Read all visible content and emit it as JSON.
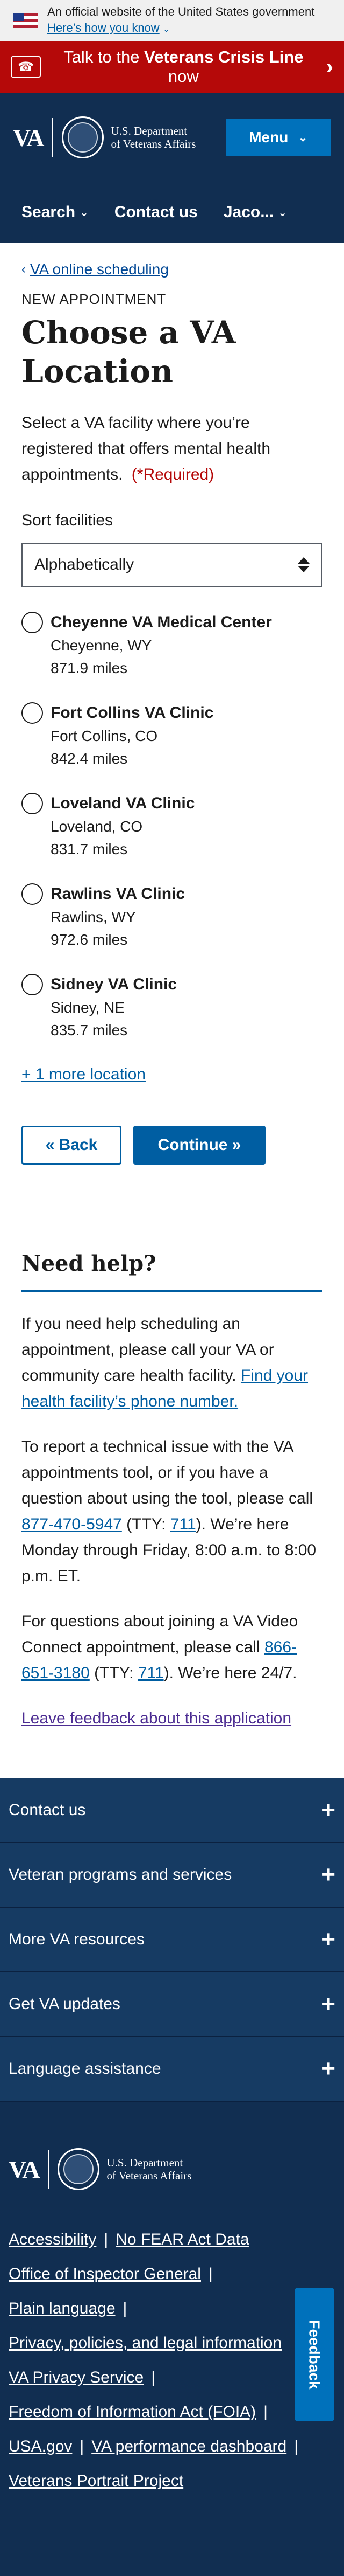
{
  "gov_banner": {
    "text": "An official website of the United States government",
    "link": "Here’s how you know"
  },
  "crisis": {
    "prefix": "Talk to the ",
    "emphasis": "Veterans Crisis Line",
    "suffix": " now"
  },
  "header": {
    "logo": "VA",
    "dept_line1": "U.S. Department",
    "dept_line2": "of Veterans Affairs",
    "menu_label": "Menu",
    "nav": [
      "Search",
      "Contact us",
      "Jaco..."
    ]
  },
  "main": {
    "breadcrumb": "VA online scheduling",
    "eyebrow": "NEW APPOINTMENT",
    "title": "Choose a VA Location",
    "intro": "Select a VA facility where you’re registered that offers mental health appointments.",
    "required": "(*Required)",
    "sort_label": "Sort facilities",
    "sort_value": "Alphabetically",
    "facilities": [
      {
        "name": "Cheyenne VA Medical Center",
        "location": "Cheyenne, WY",
        "distance": "871.9 miles"
      },
      {
        "name": "Fort Collins VA Clinic",
        "location": "Fort Collins, CO",
        "distance": "842.4 miles"
      },
      {
        "name": "Loveland VA Clinic",
        "location": "Loveland, CO",
        "distance": "831.7 miles"
      },
      {
        "name": "Rawlins VA Clinic",
        "location": "Rawlins, WY",
        "distance": "972.6 miles"
      },
      {
        "name": "Sidney VA Clinic",
        "location": "Sidney, NE",
        "distance": "835.7 miles"
      }
    ],
    "more_location": "+ 1 more location",
    "back_label": "« Back",
    "continue_label": "Continue »"
  },
  "help": {
    "title": "Need help?",
    "p1": "If you need help scheduling an appointment, please call your VA or community care health facility.",
    "p1_link": "Find your health facility’s phone number.",
    "p2_a": "To report a technical issue with the VA appointments tool, or if you have a question about using the tool, please call ",
    "p2_phone": "877-470-5947",
    "p2_b": " (TTY: ",
    "p2_tty": "711",
    "p2_c": "). We’re here Monday through Friday, 8:00 a.m. to 8:00 p.m. ET.",
    "p3_a": "For questions about joining a VA Video Connect appointment, please call ",
    "p3_phone": "866-651-3180",
    "p3_b": " (TTY: ",
    "p3_tty": "711",
    "p3_c": "). We’re here 24/7.",
    "feedback": "Leave feedback about this application"
  },
  "footer": {
    "sections": [
      "Contact us",
      "Veteran programs and services",
      "More VA resources",
      "Get VA updates",
      "Language assistance"
    ],
    "links": {
      "accessibility": "Accessibility",
      "no_fear": "No FEAR Act Data",
      "oig": "Office of Inspector General",
      "plain": "Plain language",
      "privacy": "Privacy, policies, and legal information",
      "va_privacy": "VA Privacy Service",
      "foia": "Freedom of Information Act (FOIA)",
      "usagov": "USA.gov",
      "dashboard": "VA performance dashboard",
      "portrait": "Veterans Portrait Project"
    },
    "feedback_tab": "Feedback"
  },
  "colors": {
    "navy": "#112e51",
    "crisis_red": "#b50909",
    "primary_blue": "#005ea2",
    "menu_blue": "#0071bb"
  }
}
